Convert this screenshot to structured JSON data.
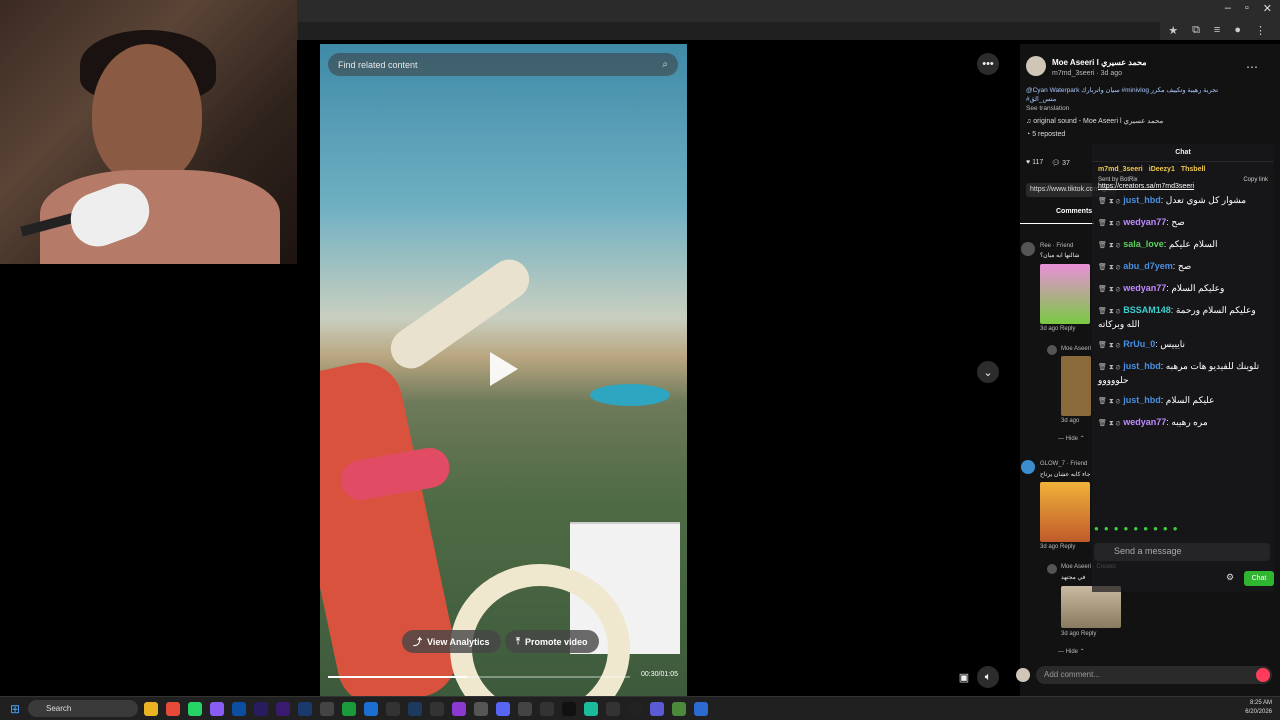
{
  "video": {
    "search_placeholder": "Find related content",
    "analytics_label": "View Analytics",
    "promote_label": "Promote video",
    "time": "00:30/01:05",
    "progress_pct": 0.46
  },
  "post": {
    "author": "Moe Aseeri l محمد عسيري",
    "handle_meta": "m7md_3seeri · 3d ago",
    "caption": "@Cyan Waterpark سيان واتربارك #minivlog تجربة رهيبة وتكييف مكرر",
    "caption_tag2": "#متس_الق",
    "see_translation": "See translation",
    "sound": "original sound - Moe Aseeri l محمد عسيري",
    "reposted": "5 reposted",
    "likes": "117",
    "comments_count": "37",
    "link": "https://www.tiktok.com/@m7md_3seeri/video/7",
    "comments_tab": "Comments"
  },
  "comments": [
    {
      "user": "Ree · Friend",
      "text": "شالتها ايه ميان؟",
      "time": "3d ago",
      "reply": "Reply"
    },
    {
      "user": "Moe Aseeri",
      "text": "",
      "time": "3d ago",
      "reply": "Reply"
    },
    {
      "user": "GLOW_7 · Friend",
      "text": "جاء كابه عشان يرتاح",
      "time": "3d ago",
      "reply": "Reply"
    },
    {
      "user": "Moe Aseeri · Creator",
      "text": "في مجتهد",
      "time": "3d ago",
      "reply": "Reply"
    }
  ],
  "hide_label": "Hide",
  "add_comment_placeholder": "Add comment...",
  "chat": {
    "title": "Chat",
    "pinned": [
      "m7md_3seeri",
      "iDeezy1",
      "Thsbell"
    ],
    "sent_by": "Sent by BotRix",
    "link": "https://creators.sa/m7md3seeri",
    "copy_link": "Copy link",
    "messages": [
      {
        "user": "just_hbd",
        "color": "#4a90e2",
        "text": "مشوار كل شوي تعدل"
      },
      {
        "user": "wedyan77",
        "color": "#c08bff",
        "text": "صح"
      },
      {
        "user": "sala_love",
        "color": "#5bd15b",
        "text": "السلام عليكم"
      },
      {
        "user": "abu_d7yem",
        "color": "#4a90e2",
        "text": "صح"
      },
      {
        "user": "wedyan77",
        "color": "#c08bff",
        "text": "وعليكم السلام"
      },
      {
        "user": "BSSAM148",
        "color": "#3ecfcf",
        "text": "وعليكم السلام ورحمة الله وبركاته"
      },
      {
        "user": "RrUu_0",
        "color": "#4a90e2",
        "text": "نايييس"
      },
      {
        "user": "just_hbd",
        "color": "#4a90e2",
        "text": "تلوينك للفيديو هات مرهبه حلووووو"
      },
      {
        "user": "just_hbd",
        "color": "#4a90e2",
        "text": "عليكم السلام"
      },
      {
        "user": "wedyan77",
        "color": "#c08bff",
        "text": "مره رهيبه"
      }
    ],
    "input_placeholder": "Send a message",
    "chat_button": "Chat"
  },
  "taskbar": {
    "search_label": "Search",
    "time": "8:25 AM",
    "date": "6/20/2026"
  }
}
